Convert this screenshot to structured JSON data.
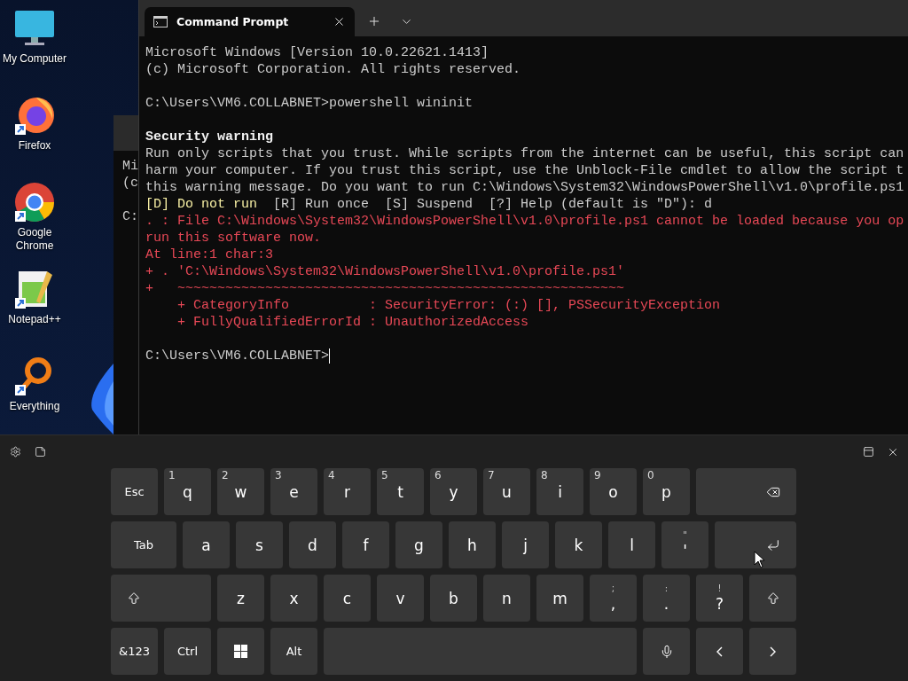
{
  "desktop": {
    "icons": [
      {
        "kind": "monitor",
        "label": "My Computer",
        "shortcut": false
      },
      {
        "kind": "firefox",
        "label": "Firefox",
        "shortcut": true
      },
      {
        "kind": "chrome",
        "label": "Google Chrome",
        "shortcut": true
      },
      {
        "kind": "notepad",
        "label": "Notepad++",
        "shortcut": true
      },
      {
        "kind": "everything",
        "label": "Everything",
        "shortcut": true
      }
    ]
  },
  "back_window": {
    "lines": [
      {
        "kind": "plain",
        "text": "Mi"
      },
      {
        "kind": "plain",
        "text": "(c"
      },
      {
        "kind": "blank"
      },
      {
        "kind": "plain",
        "text": "C:"
      }
    ]
  },
  "terminal": {
    "tab": {
      "title": "Command Prompt",
      "selected": true
    },
    "lines": [
      {
        "kind": "plain",
        "text": "Microsoft Windows [Version 10.0.22621.1413]"
      },
      {
        "kind": "plain",
        "text": "(c) Microsoft Corporation. All rights reserved."
      },
      {
        "kind": "blank"
      },
      {
        "kind": "plain",
        "text": "C:\\Users\\VM6.COLLABNET>powershell wininit"
      },
      {
        "kind": "blank"
      },
      {
        "kind": "bold",
        "text": "Security warning"
      },
      {
        "kind": "plain",
        "text": "Run only scripts that you trust. While scripts from the internet can be useful, this script can"
      },
      {
        "kind": "plain",
        "text": "harm your computer. If you trust this script, use the Unblock-File cmdlet to allow the script t"
      },
      {
        "kind": "plain",
        "text": "this warning message. Do you want to run C:\\Windows\\System32\\WindowsPowerShell\\v1.0\\profile.ps1"
      },
      {
        "kind": "choice",
        "highlighted": "[D] Do not run",
        "text": "[R] Run once  [S] Suspend  [?] Help (default is \"D\"): d"
      },
      {
        "kind": "error",
        "text": ". : File C:\\Windows\\System32\\WindowsPowerShell\\v1.0\\profile.ps1 cannot be loaded because you op"
      },
      {
        "kind": "error",
        "text": "run this software now."
      },
      {
        "kind": "error",
        "text": "At line:1 char:3"
      },
      {
        "kind": "error",
        "text": "+ . 'C:\\Windows\\System32\\WindowsPowerShell\\v1.0\\profile.ps1'"
      },
      {
        "kind": "error",
        "text": "+   ~~~~~~~~~~~~~~~~~~~~~~~~~~~~~~~~~~~~~~~~~~~~~~~~~~~~~~~~"
      },
      {
        "kind": "error",
        "text": "    + CategoryInfo          : SecurityError: (:) [], PSSecurityException"
      },
      {
        "kind": "error",
        "text": "    + FullyQualifiedErrorId : UnauthorizedAccess"
      },
      {
        "kind": "blank"
      },
      {
        "kind": "prompt",
        "text": "C:\\Users\\VM6.COLLABNET>"
      }
    ]
  },
  "keyboard": {
    "rows": [
      {
        "keys": [
          {
            "kind": "text",
            "label": "Esc"
          },
          {
            "kind": "letter",
            "label": "q",
            "hint": "1"
          },
          {
            "kind": "letter",
            "label": "w",
            "hint": "2"
          },
          {
            "kind": "letter",
            "label": "e",
            "hint": "3"
          },
          {
            "kind": "letter",
            "label": "r",
            "hint": "4"
          },
          {
            "kind": "letter",
            "label": "t",
            "hint": "5"
          },
          {
            "kind": "letter",
            "label": "y",
            "hint": "6"
          },
          {
            "kind": "letter",
            "label": "u",
            "hint": "7"
          },
          {
            "kind": "letter",
            "label": "i",
            "hint": "8"
          },
          {
            "kind": "letter",
            "label": "o",
            "hint": "9"
          },
          {
            "kind": "letter",
            "label": "p",
            "hint": "0"
          },
          {
            "kind": "backspace"
          }
        ]
      },
      {
        "keys": [
          {
            "kind": "tab",
            "label": "Tab"
          },
          {
            "kind": "letter",
            "label": "a"
          },
          {
            "kind": "letter",
            "label": "s"
          },
          {
            "kind": "letter",
            "label": "d"
          },
          {
            "kind": "letter",
            "label": "f"
          },
          {
            "kind": "letter",
            "label": "g"
          },
          {
            "kind": "letter",
            "label": "h"
          },
          {
            "kind": "letter",
            "label": "j"
          },
          {
            "kind": "letter",
            "label": "k"
          },
          {
            "kind": "letter",
            "label": "l"
          },
          {
            "kind": "punct",
            "label": "'",
            "hint": "\""
          },
          {
            "kind": "enter"
          }
        ]
      },
      {
        "keys": [
          {
            "kind": "shift"
          },
          {
            "kind": "letter",
            "label": "z"
          },
          {
            "kind": "letter",
            "label": "x"
          },
          {
            "kind": "letter",
            "label": "c"
          },
          {
            "kind": "letter",
            "label": "v"
          },
          {
            "kind": "letter",
            "label": "b"
          },
          {
            "kind": "letter",
            "label": "n"
          },
          {
            "kind": "letter",
            "label": "m"
          },
          {
            "kind": "punct",
            "label": ",",
            "hint": ";"
          },
          {
            "kind": "punct",
            "label": ".",
            "hint": ":"
          },
          {
            "kind": "punct",
            "label": "?",
            "hint": "!"
          },
          {
            "kind": "shift"
          }
        ]
      },
      {
        "keys": [
          {
            "kind": "text",
            "label": "&123"
          },
          {
            "kind": "text",
            "label": "Ctrl"
          },
          {
            "kind": "windows"
          },
          {
            "kind": "text",
            "label": "Alt"
          },
          {
            "kind": "space"
          },
          {
            "kind": "mic"
          },
          {
            "kind": "left"
          },
          {
            "kind": "right"
          }
        ]
      }
    ]
  }
}
